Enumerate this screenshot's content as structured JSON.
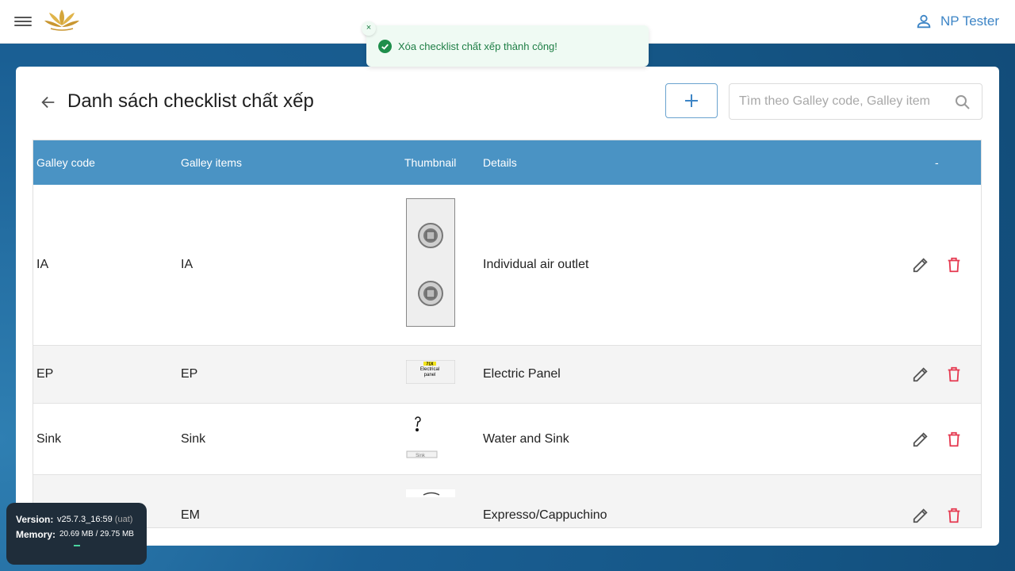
{
  "header": {
    "user_name": "NP Tester",
    "menu_icon": "hamburger-menu-icon",
    "logo": "lotus-logo"
  },
  "page": {
    "title": "Danh sách checklist chất xếp",
    "search_placeholder": "Tìm theo Galley code, Galley item"
  },
  "table": {
    "columns": [
      "Galley code",
      "Galley items",
      "Thumbnail",
      "Details",
      "-"
    ],
    "rows": [
      {
        "code": "IA",
        "item": "IA",
        "details": "Individual air outlet"
      },
      {
        "code": "EP",
        "item": "EP",
        "details": "Electric Panel"
      },
      {
        "code": "Sink",
        "item": "Sink",
        "details": "Water and Sink"
      },
      {
        "code": "",
        "item": "EM",
        "details": "Expresso/Cappuchino"
      }
    ],
    "thumb_ep_text_line1": "Electrical",
    "thumb_ep_text_line2": "panel",
    "thumb_ep_tag": "71X",
    "thumb_sink_text": "Sink"
  },
  "toast": {
    "message": "Xóa checklist chất xếp thành công!",
    "close_symbol": "×"
  },
  "version_panel": {
    "version_label": "Version:",
    "version_value": "v25.7.3_16:59",
    "env": "(uat)",
    "memory_label": "Memory:",
    "memory_value": "20.69 MB / 29.75 MB"
  },
  "colors": {
    "header_bg": "#4a93c4",
    "accent": "#3d85c6",
    "delete": "#e53950",
    "toast_bg": "#effaf3",
    "toast_text": "#1e7e45"
  }
}
